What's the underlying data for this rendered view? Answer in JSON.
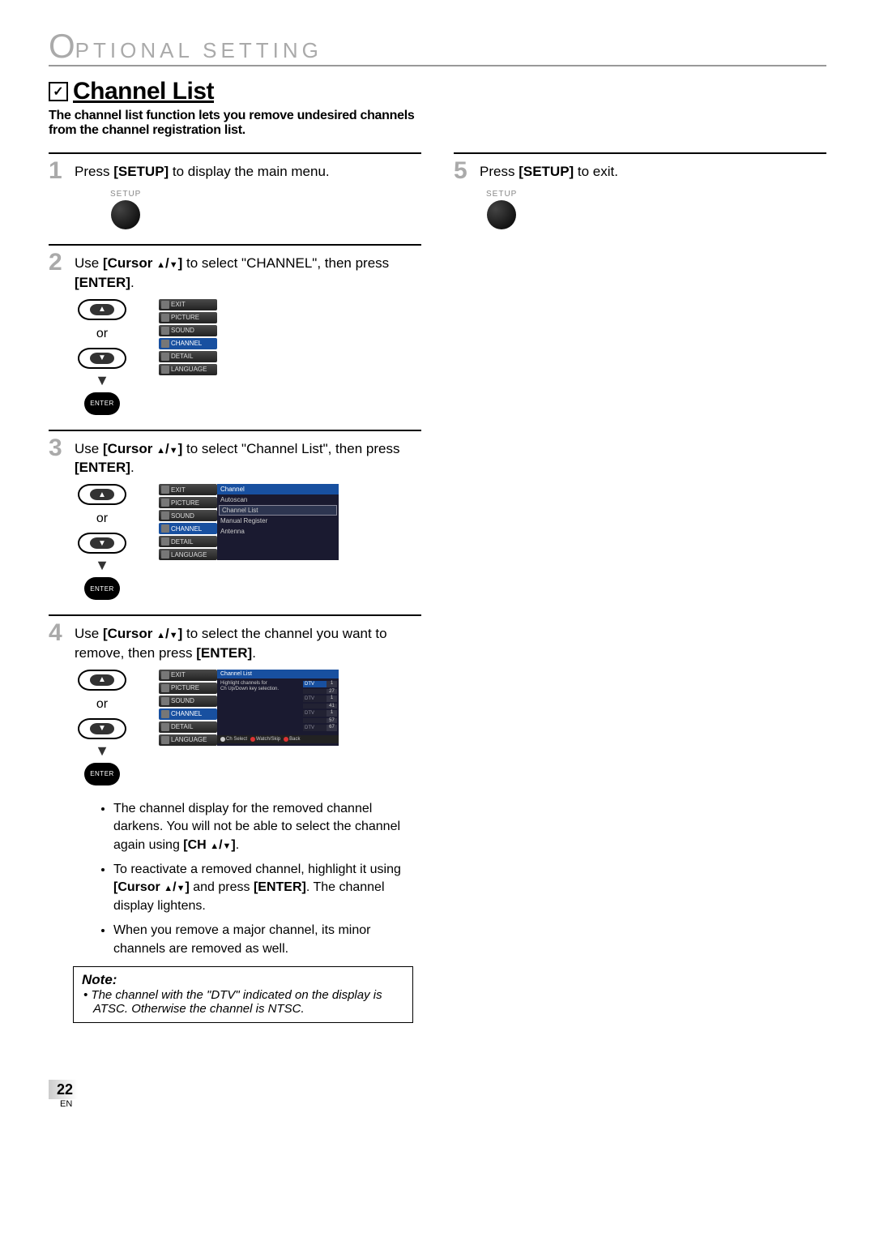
{
  "header": {
    "letter": "O",
    "rest": "PTIONAL   SETTING"
  },
  "section": {
    "title": "Channel List",
    "description": "The channel list function lets you remove undesired channels from the channel registration list."
  },
  "osd": {
    "items": [
      "EXIT",
      "PICTURE",
      "SOUND",
      "CHANNEL",
      "DETAIL",
      "LANGUAGE"
    ],
    "channel_header": "Channel",
    "channel_sub": [
      "Autoscan",
      "Channel List",
      "Manual Register",
      "Antenna"
    ],
    "cl_header": "Channel List",
    "cl_hint1": "Highlight channels for",
    "cl_hint2": "Ch Up/Down key selection.",
    "cl_rows": [
      {
        "a": "DTV",
        "b": "1"
      },
      {
        "a": "",
        "b": "27"
      },
      {
        "a": "DTV",
        "b": "1"
      },
      {
        "a": "",
        "b": "41"
      },
      {
        "a": "DTV",
        "b": "1"
      },
      {
        "a": "",
        "b": "57"
      },
      {
        "a": "DTV",
        "b": "67"
      }
    ],
    "cl_footer": {
      "select": "Ch Select",
      "watch": "Watch/Skip",
      "back": "Back"
    }
  },
  "remote": {
    "or": "or",
    "enter": "ENTER",
    "setup": "SETUP"
  },
  "steps": {
    "s1": {
      "num": "1",
      "pre": "Press ",
      "btn": "[SETUP]",
      "post": " to display the main menu."
    },
    "s2": {
      "num": "2",
      "pre": "Use ",
      "btn": "[Cursor ",
      "post": " to select \"CHANNEL\", then press ",
      "enter": "[ENTER]",
      "end": "."
    },
    "s3": {
      "num": "3",
      "pre": "Use ",
      "btn": "[Cursor ",
      "post": " to select \"Channel List\", then press ",
      "enter": "[ENTER]",
      "end": "."
    },
    "s4": {
      "num": "4",
      "pre": "Use ",
      "btn": "[Cursor ",
      "post": " to select the channel you want to remove, then press ",
      "enter": "[ENTER]",
      "end": "."
    },
    "s5": {
      "num": "5",
      "pre": "Press ",
      "btn": "[SETUP]",
      "post": " to exit."
    }
  },
  "bullets": {
    "b1a": "The channel display for the removed channel darkens. You will not be able to select the channel again using ",
    "b1b": "[CH ",
    "b1c": ".",
    "b2a": "To reactivate a removed channel, highlight it using ",
    "b2b": "[Cursor ",
    "b2c": " and press ",
    "b2d": "[ENTER]",
    "b2e": ". The channel display lightens.",
    "b3": "When you remove a major channel, its minor channels are removed as well."
  },
  "note": {
    "title": "Note:",
    "body": "The channel with the \"DTV\" indicated on the display is ATSC. Otherwise the channel is NTSC."
  },
  "footer": {
    "page": "22",
    "lang": "EN"
  }
}
